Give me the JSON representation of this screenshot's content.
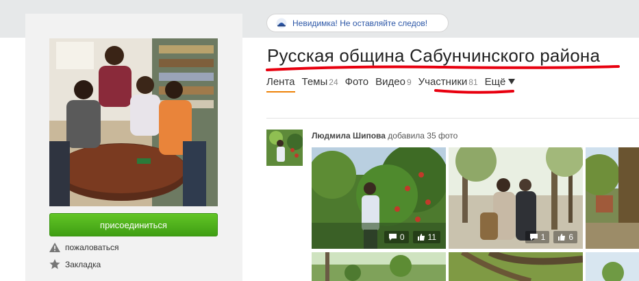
{
  "promo": {
    "text": "Невидимка! Не оставляйте следов!"
  },
  "group": {
    "title": "Русская община Сабунчинского района"
  },
  "tabs": [
    {
      "label": "Лента",
      "count": ""
    },
    {
      "label": "Темы",
      "count": "24"
    },
    {
      "label": "Фото",
      "count": ""
    },
    {
      "label": "Видео",
      "count": "9"
    },
    {
      "label": "Участники",
      "count": "81"
    },
    {
      "label": "Ещё",
      "count": ""
    }
  ],
  "sidebar": {
    "join_label": "присоединиться",
    "report_label": "пожаловаться",
    "bookmark_label": "Закладка"
  },
  "feed": {
    "author": "Людмила Шипова",
    "action": "добавила 35 фото",
    "photos": [
      {
        "comments": "0",
        "likes": "11"
      },
      {
        "comments": "1",
        "likes": "6"
      }
    ]
  },
  "colors": {
    "accent": "#ee8208",
    "join": "#4caf1a",
    "link": "#2a55a6",
    "annotation": "#e8000f"
  }
}
